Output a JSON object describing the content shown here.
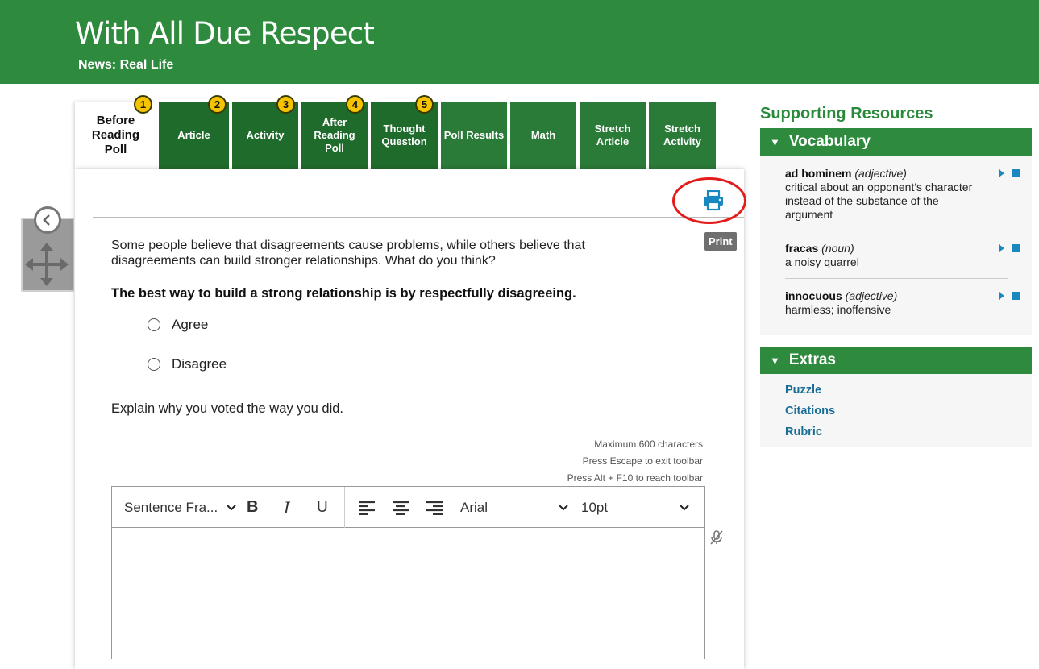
{
  "header": {
    "title": "With All Due Respect",
    "subtitle": "News: Real Life"
  },
  "tabs": [
    {
      "label": "Before Reading Poll",
      "badge": "1"
    },
    {
      "label": "Article",
      "badge": "2"
    },
    {
      "label": "Activity",
      "badge": "3"
    },
    {
      "label": "After Reading Poll",
      "badge": "4"
    },
    {
      "label": "Thought Question",
      "badge": "5"
    },
    {
      "label": "Poll Results"
    },
    {
      "label": "Math"
    },
    {
      "label": "Stretch Article"
    },
    {
      "label": "Stretch Activity"
    }
  ],
  "main": {
    "print_tooltip": "Print",
    "question": "Some people believe that disagreements cause problems, while others believe that disagreements can build stronger relationships. What do you think?",
    "statement": "The best way to build a strong relationship is by respectfully disagreeing.",
    "options": [
      "Agree",
      "Disagree"
    ],
    "explain_prompt": "Explain why you voted the way you did.",
    "hints": [
      "Maximum 600 characters",
      "Press Escape to exit toolbar",
      "Press Alt + F10 to reach toolbar"
    ],
    "editor": {
      "format_select": "Sentence Fra...",
      "bold": "B",
      "italic": "I",
      "underline": "U",
      "font_select": "Arial",
      "size_select": "10pt"
    }
  },
  "resources": {
    "title": "Supporting Resources",
    "vocabulary_header": "Vocabulary",
    "vocab": [
      {
        "word": "ad hominem",
        "pos": "(adjective)",
        "definition": "critical about an opponent's character instead of the substance of the argument"
      },
      {
        "word": "fracas",
        "pos": "(noun)",
        "definition": "a noisy quarrel"
      },
      {
        "word": "innocuous",
        "pos": "(adjective)",
        "definition": "harmless; inoffensive"
      }
    ],
    "extras_header": "Extras",
    "extras": [
      "Puzzle",
      "Citations",
      "Rubric"
    ]
  },
  "colors": {
    "brand_green": "#2e8b3e",
    "dark_tab": "#1f6b2c",
    "badge_yellow": "#f5c400",
    "link_blue": "#1a6d95",
    "highlight_red": "#e31b1b"
  }
}
